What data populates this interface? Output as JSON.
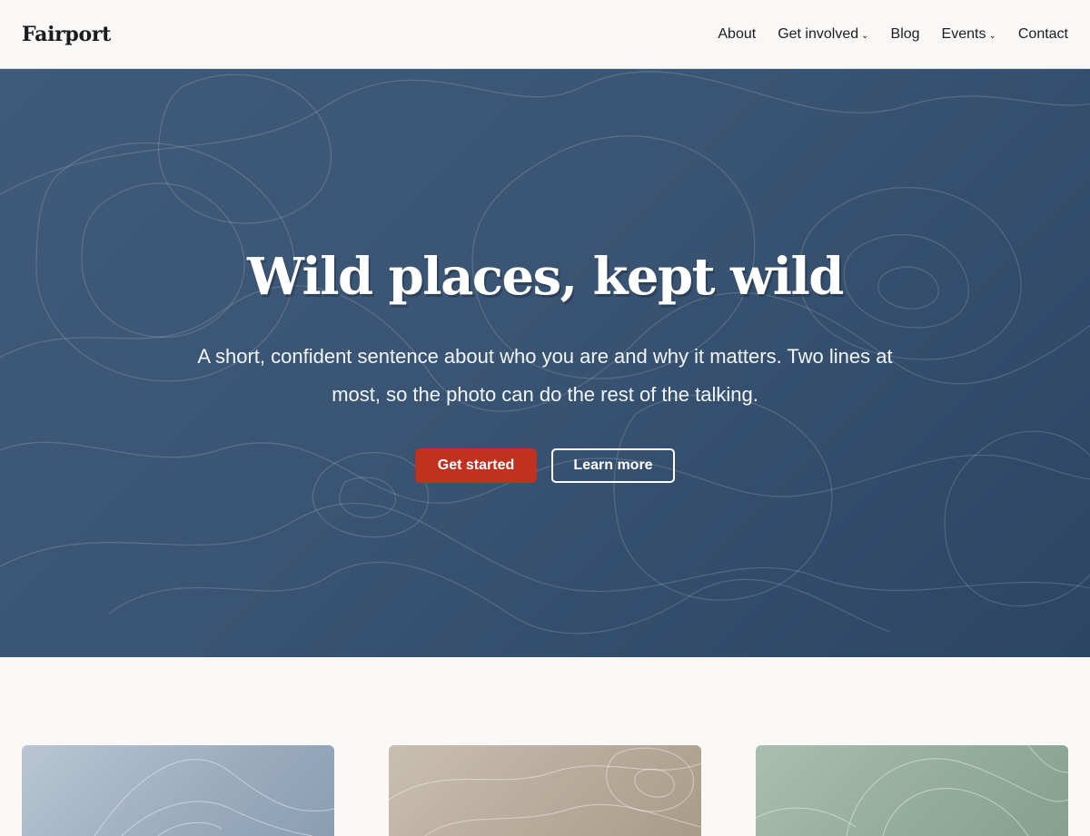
{
  "header": {
    "brand": "Fairport",
    "nav": [
      {
        "label": "About",
        "has_dropdown": false
      },
      {
        "label": "Get involved",
        "has_dropdown": true
      },
      {
        "label": "Blog",
        "has_dropdown": false
      },
      {
        "label": "Events",
        "has_dropdown": true
      },
      {
        "label": "Contact",
        "has_dropdown": false
      }
    ]
  },
  "hero": {
    "title": "Wild places, kept wild",
    "subtitle": "A short, confident sentence about who you are and why it matters. Two lines at most, so the photo can do the rest of the talking.",
    "primary_button": "Get started",
    "secondary_button": "Learn more"
  },
  "colors": {
    "hero_background": "#3a5573",
    "primary_button": "#c0321f",
    "page_background": "#faf8f6"
  },
  "icons": {
    "dropdown": "chevron-down-icon"
  }
}
